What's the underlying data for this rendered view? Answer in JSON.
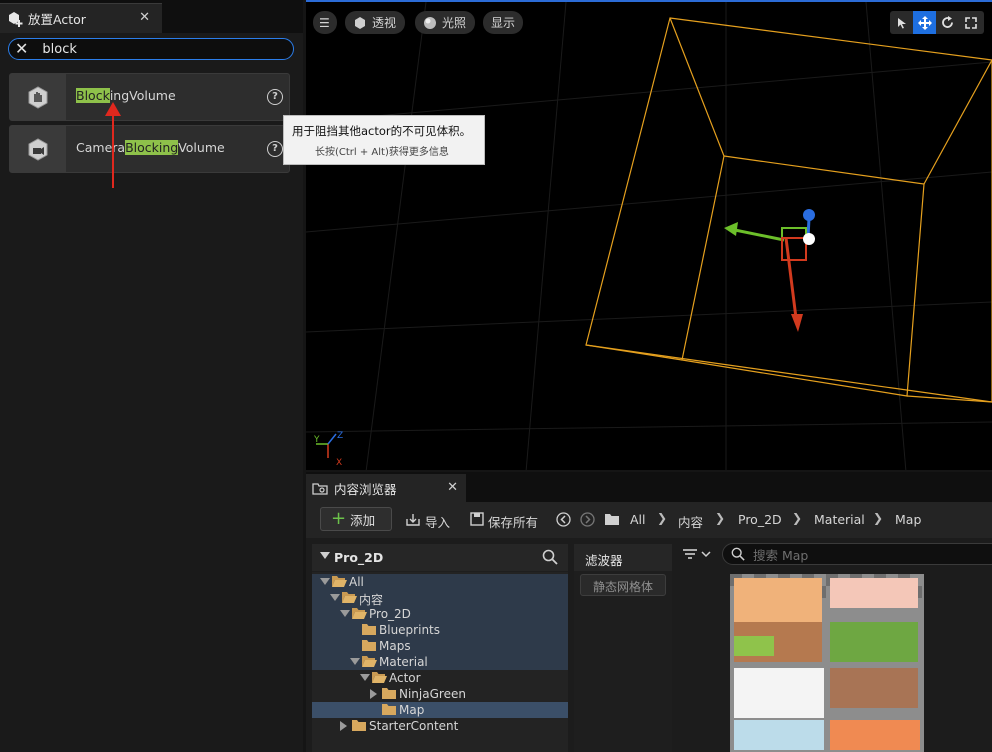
{
  "place_actors": {
    "tab_title": "放置Actor",
    "tab_close": "✕",
    "search_clear": "✕",
    "search_value": "block",
    "results": [
      {
        "pre": "",
        "hl": "Block",
        "post": "ingVolume",
        "icon": "hand-cube-icon"
      },
      {
        "pre": "Camera",
        "hl": "Blocking",
        "post": "Volume",
        "icon": "camera-cube-icon"
      }
    ],
    "help_glyph": "?"
  },
  "tooltip": {
    "line1": "用于阻挡其他actor的不可见体积。",
    "line2": "长按(Ctrl + Alt)获得更多信息"
  },
  "viewport": {
    "menu_glyph": "☰",
    "perspective_label": "透视",
    "lit_label": "光照",
    "show_label": "显示",
    "tools": [
      "select-icon",
      "translate-icon",
      "rotate-icon",
      "scale-icon"
    ],
    "active_tool": "translate-icon",
    "axis_labels": [
      "Y",
      "Z",
      "X"
    ]
  },
  "content_browser": {
    "tab_title": "内容浏览器",
    "tab_close": "✕",
    "add_label": "添加",
    "import_label": "导入",
    "save_all_label": "保存所有",
    "breadcrumb": [
      "All",
      "内容",
      "Pro_2D",
      "Material",
      "Map"
    ],
    "tree_header": "Pro_2D",
    "tree": [
      {
        "label": "All",
        "depth": 0,
        "expanded": true
      },
      {
        "label": "内容",
        "depth": 1,
        "expanded": true
      },
      {
        "label": "Pro_2D",
        "depth": 2,
        "expanded": true
      },
      {
        "label": "Blueprints",
        "depth": 3,
        "expanded": null
      },
      {
        "label": "Maps",
        "depth": 3,
        "expanded": null
      },
      {
        "label": "Material",
        "depth": 3,
        "expanded": true
      },
      {
        "label": "Actor",
        "depth": 4,
        "expanded": true
      },
      {
        "label": "NinjaGreen",
        "depth": 5,
        "expanded": false
      },
      {
        "label": "Map",
        "depth": 5,
        "expanded": null
      },
      {
        "label": "StarterContent",
        "depth": 2,
        "expanded": false
      }
    ],
    "filters_title": "滤波器",
    "filter_chip": "静态网格体",
    "asset_search_placeholder": "搜索 Map"
  }
}
